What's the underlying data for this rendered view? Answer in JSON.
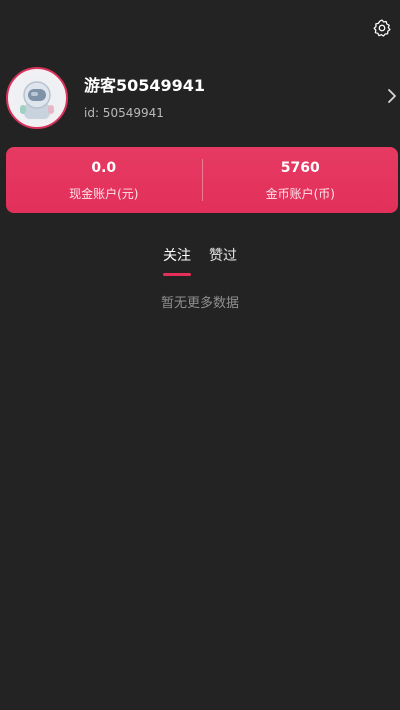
{
  "header": {
    "settings_icon": "gear-icon"
  },
  "profile": {
    "username": "游客50549941",
    "user_id": "id: 50549941",
    "avatar_icon": "astronaut-avatar",
    "chevron_icon": "chevron-right-icon"
  },
  "accounts": {
    "cash": {
      "value": "0.0",
      "label": "现金账户(元)"
    },
    "coins": {
      "value": "5760",
      "label": "金币账户(币)"
    },
    "accent_color": "#e2305a"
  },
  "tabs": [
    {
      "label": "关注",
      "active": true
    },
    {
      "label": "赞过",
      "active": false
    }
  ],
  "empty_state": {
    "message": "暂无更多数据"
  }
}
